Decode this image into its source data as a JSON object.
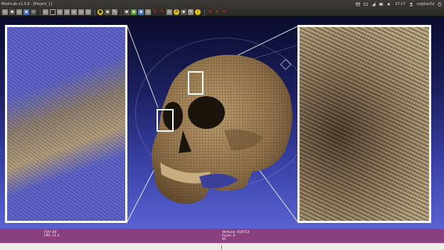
{
  "window": {
    "title": "MeshLab v1.3.0 - [Project_1]"
  },
  "toolbar": {
    "icons": [
      "new-project-icon",
      "open-project-icon",
      "open-mesh-icon",
      "save-icon",
      "snapshot-icon",
      "fullscreen-icon",
      "trackball-icon",
      "wireframe-icon",
      "points-icon",
      "flat-icon",
      "smooth-icon",
      "texture-icon",
      "lighting-icon",
      "backface-icon",
      "selection-icon",
      "layers-icon",
      "colors-icon",
      "align-icon",
      "measure-icon",
      "paint-icon",
      "annotation-icon",
      "brush-icon",
      "info-icon",
      "delete-face-icon",
      "delete-vert-icon",
      "delete-all-icon"
    ]
  },
  "tray": {
    "time": "17:17",
    "user": "cogitas3d"
  },
  "info": {
    "fov_label": "FOV:",
    "fov_value": "60",
    "fps_label": "FPS:",
    "fps_value": "11.3",
    "vertices_label": "Vertices:",
    "vertices_value": "418753",
    "faces_label": "Faces:",
    "faces_value": "0",
    "vc_label": "VC"
  }
}
